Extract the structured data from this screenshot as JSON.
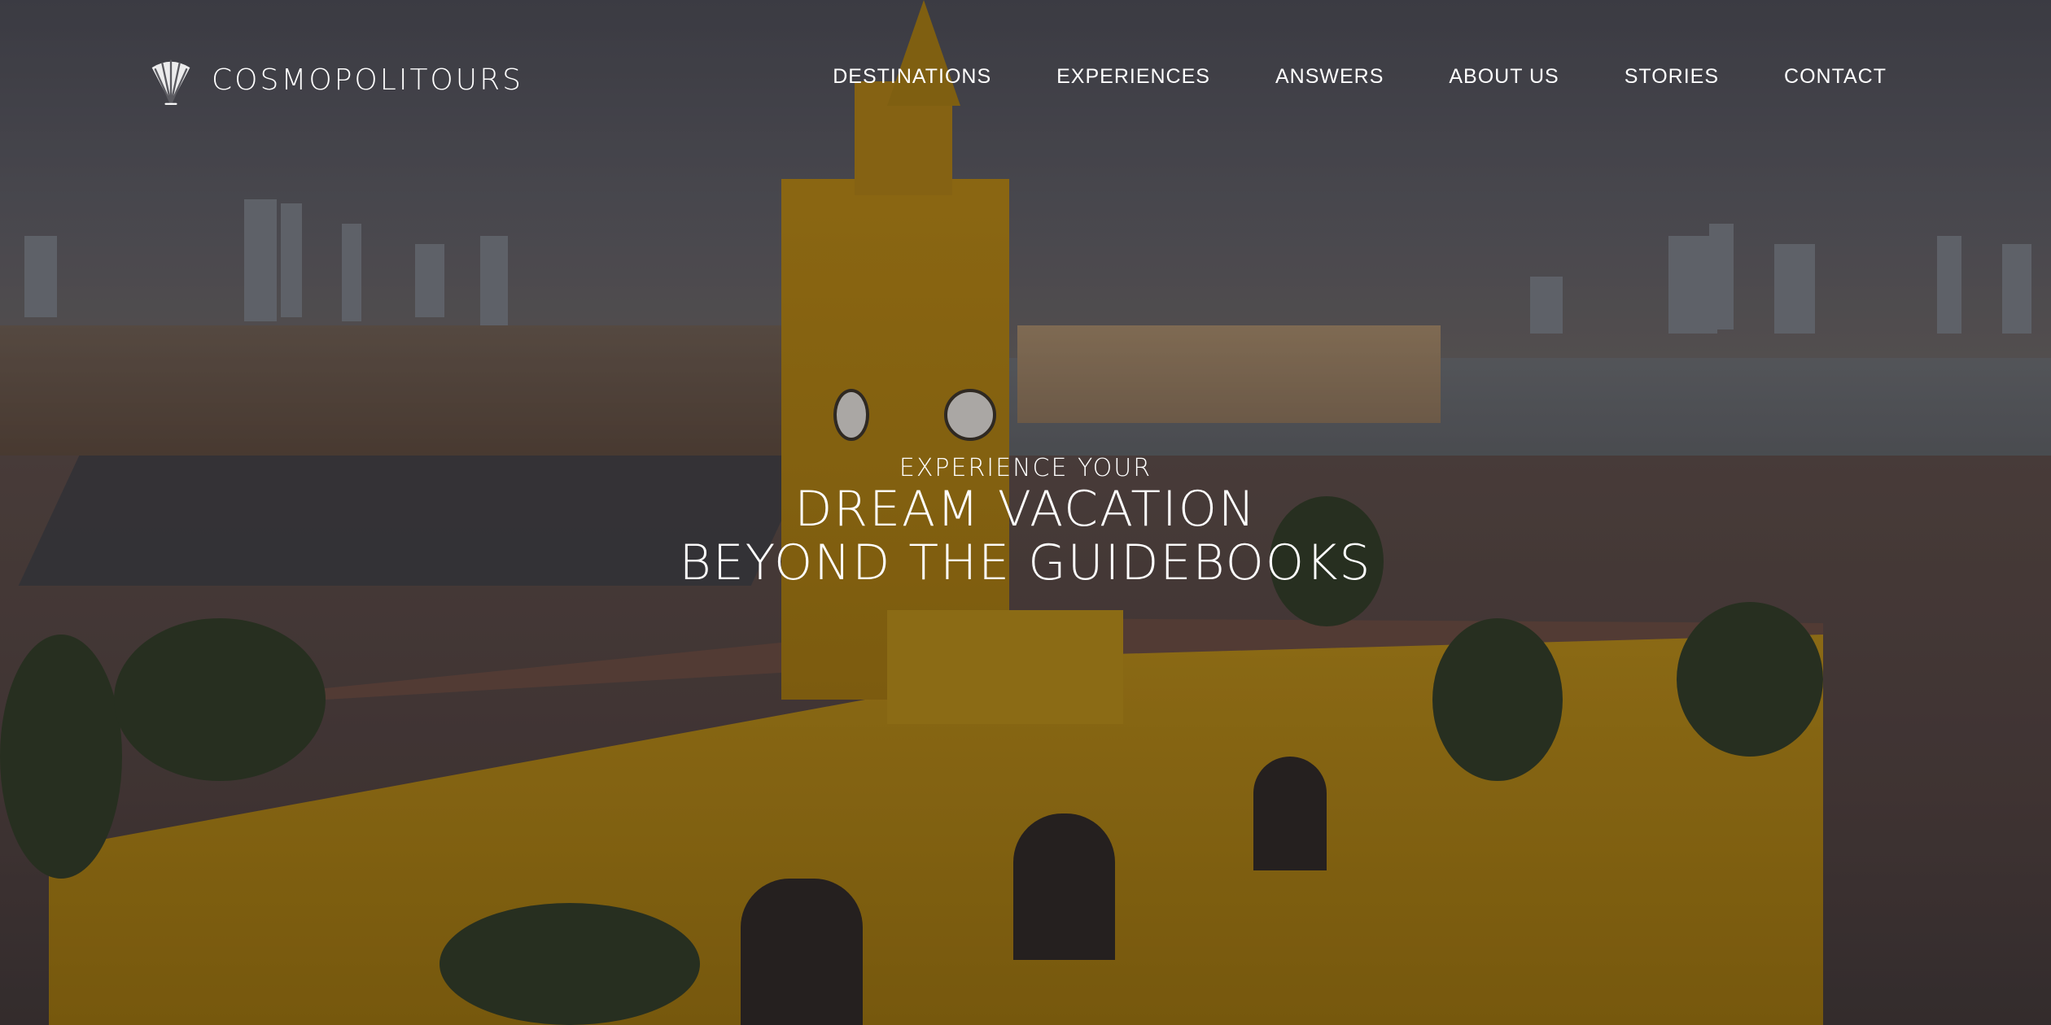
{
  "brand": {
    "name": "COSMOPOLITOURS",
    "logo_icon": "shell-fan-icon"
  },
  "nav": {
    "items": [
      {
        "label": "DESTINATIONS"
      },
      {
        "label": "EXPERIENCES"
      },
      {
        "label": "ANSWERS"
      },
      {
        "label": "ABOUT US"
      },
      {
        "label": "STORIES"
      },
      {
        "label": "CONTACT"
      }
    ]
  },
  "hero": {
    "kicker": "EXPERIENCE YOUR",
    "line1": "DREAM VACATION",
    "line2": "BEYOND THE GUIDEBOOKS"
  },
  "colors": {
    "text": "#ffffff",
    "accent_wall": "#b88a12"
  }
}
